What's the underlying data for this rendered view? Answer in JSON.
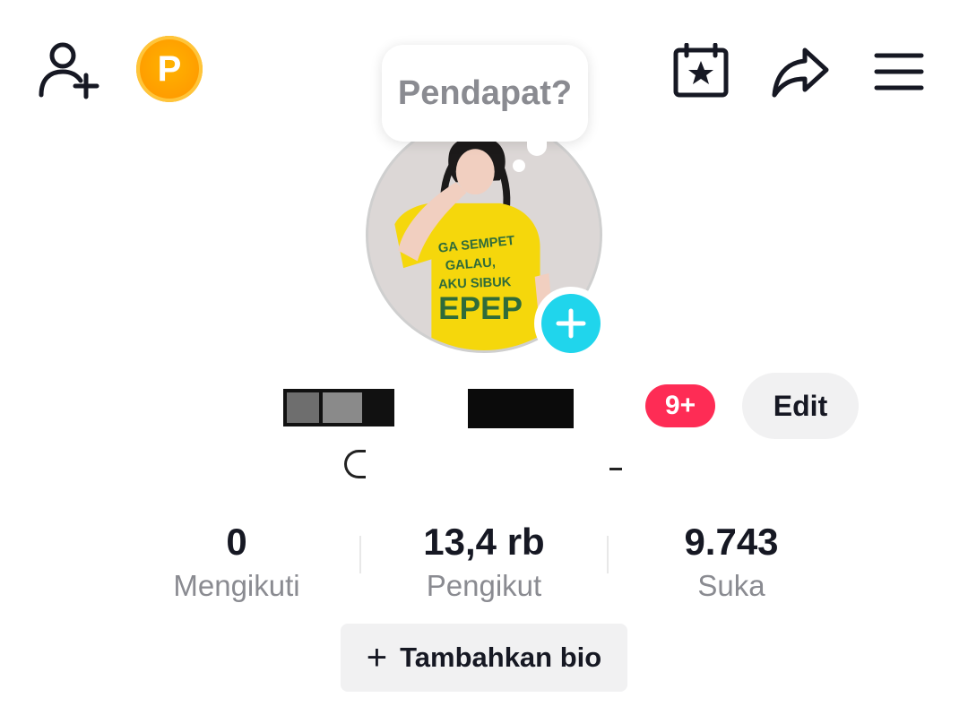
{
  "header": {
    "add_user_icon": "add-user-icon",
    "points_label": "P",
    "calendar_icon": "calendar-star-icon",
    "share_icon": "share-icon",
    "menu_icon": "hamburger-menu-icon"
  },
  "bubble": {
    "text": "Pendapat?"
  },
  "avatar": {
    "shirt_lines": [
      "GA SEMPET",
      "GALAU,",
      "AKU SIBUK",
      "EPEP"
    ]
  },
  "profile": {
    "notification_badge": "9+",
    "edit_label": "Edit"
  },
  "stats": [
    {
      "value": "0",
      "label": "Mengikuti"
    },
    {
      "value": "13,4 rb",
      "label": "Pengikut"
    },
    {
      "value": "9.743",
      "label": "Suka"
    }
  ],
  "bio": {
    "add_label": "Tambahkan bio"
  },
  "colors": {
    "accent_pink": "#fe2c55",
    "accent_cyan": "#20d5ec",
    "points_orange": "#ffa000"
  }
}
